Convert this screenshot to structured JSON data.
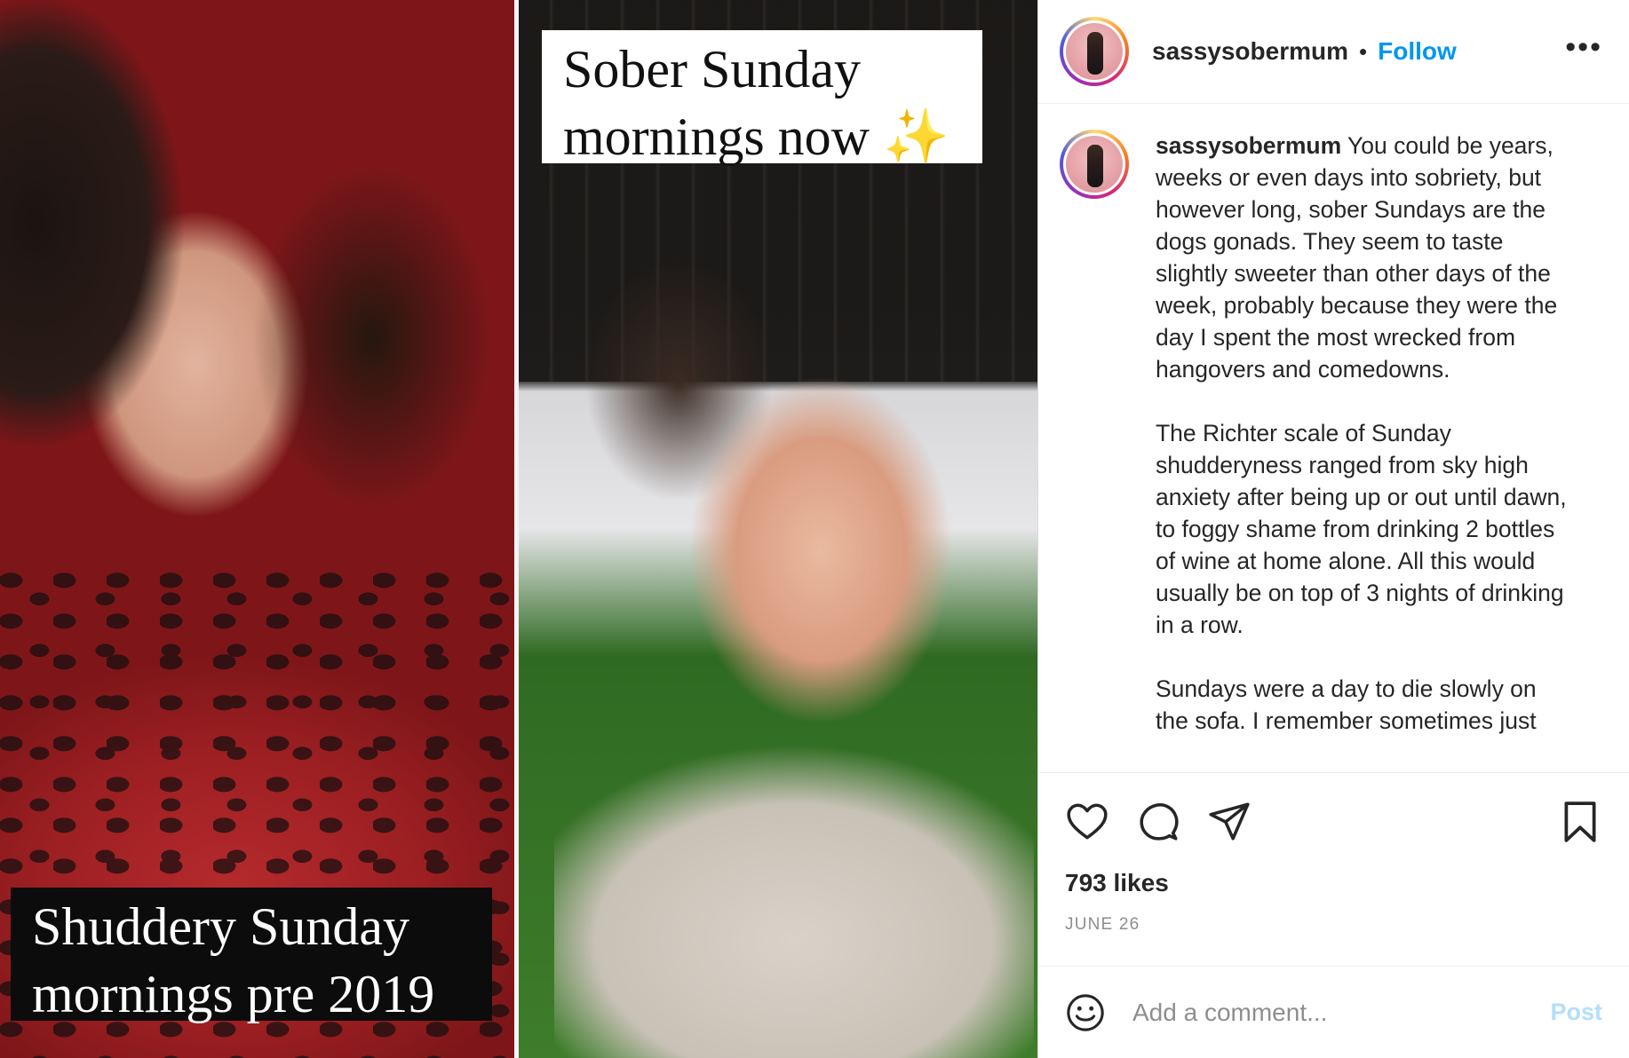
{
  "post": {
    "username": "sassysobermum",
    "follow_label": "Follow",
    "separator": "•",
    "more_label": "•••"
  },
  "media": {
    "top_caption_line1": "Sober Sunday",
    "top_caption_line2": "mornings now",
    "sparkle": "✨",
    "bottom_caption_line1": "Shuddery Sunday",
    "bottom_caption_line2": "mornings pre 2019"
  },
  "caption": {
    "username": "sassysobermum",
    "text": " You could be years, weeks or even days into sobriety, but however long, sober Sundays are the dogs gonads. They seem to taste slightly sweeter than other days of the week, probably because they were the day I spent the most wrecked from hangovers and comedowns.\n\nThe Richter scale of Sunday shudderyness ranged from sky high anxiety after being up or out until dawn, to foggy shame from drinking 2 bottles of wine at home alone. All this would usually be on top of 3 nights of drinking in a row.\n\nSundays were a day to die slowly on the sofa. I remember sometimes just"
  },
  "engagement": {
    "likes": "793 likes",
    "date": "JUNE 26"
  },
  "comment_box": {
    "placeholder": "Add a comment...",
    "post_label": "Post"
  },
  "icons": {
    "like": "heart-icon",
    "comment": "comment-icon",
    "share": "paper-plane-icon",
    "save": "bookmark-icon",
    "emoji": "smiley-icon"
  },
  "colors": {
    "follow": "#0095f6",
    "post_disabled": "#b2dffc",
    "muted": "#8e8e8e",
    "text": "#262626"
  }
}
